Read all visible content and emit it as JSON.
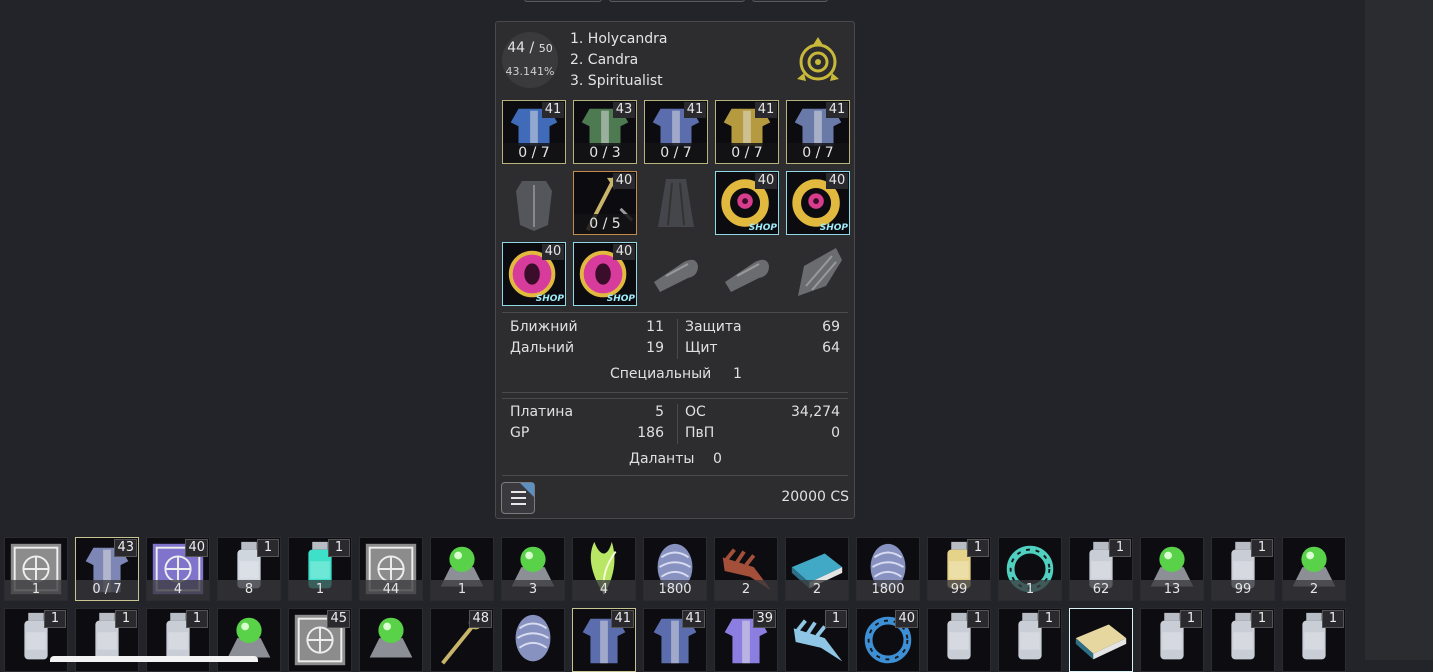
{
  "profile": {
    "level_current": "44",
    "level_sep": " / ",
    "level_max": "50",
    "level_percent": "43.141%",
    "classes": [
      "1. Holycandra",
      "2. Candra",
      "3. Spiritualist"
    ]
  },
  "gear_rows": [
    [
      {
        "name": "armor-top",
        "level": "41",
        "upgrade": "0 / 7",
        "frame": "bordered",
        "color": "#3f6bb8"
      },
      {
        "name": "armor-bottom",
        "level": "43",
        "upgrade": "0 / 3",
        "frame": "bordered",
        "color": "#4e7a52"
      },
      {
        "name": "gloves",
        "level": "41",
        "upgrade": "0 / 7",
        "frame": "bordered",
        "color": "#5b6dad"
      },
      {
        "name": "shoes",
        "level": "41",
        "upgrade": "0 / 7",
        "frame": "bordered",
        "color": "#b59a3f"
      },
      {
        "name": "helm",
        "level": "41",
        "upgrade": "0 / 7",
        "frame": "bordered",
        "color": "#6a7aa8"
      }
    ],
    [
      {
        "name": "shield-slot",
        "level": "",
        "upgrade": "",
        "frame": "empty",
        "color": "#55565c"
      },
      {
        "name": "weapon",
        "level": "40",
        "upgrade": "0 / 5",
        "frame": "bordered-orange",
        "color": "#c9b56a"
      },
      {
        "name": "cape-slot",
        "level": "",
        "upgrade": "",
        "frame": "empty",
        "color": "#45464b"
      },
      {
        "name": "ring-1",
        "level": "40",
        "upgrade": "",
        "frame": "bordered-cyan",
        "color": "#e2b93f",
        "shop": "SHOP"
      },
      {
        "name": "ring-2",
        "level": "40",
        "upgrade": "",
        "frame": "bordered-cyan",
        "color": "#e2b93f",
        "shop": "SHOP"
      }
    ],
    [
      {
        "name": "earring-1",
        "level": "40",
        "upgrade": "",
        "frame": "bordered-cyan",
        "color": "#d73c9c",
        "shop": "SHOP"
      },
      {
        "name": "earring-2",
        "level": "40",
        "upgrade": "",
        "frame": "bordered-cyan",
        "color": "#d73c9c",
        "shop": "SHOP"
      },
      {
        "name": "bullet-slot-1",
        "level": "",
        "upgrade": "",
        "frame": "empty",
        "color": "#6b6c70"
      },
      {
        "name": "bullet-slot-2",
        "level": "",
        "upgrade": "",
        "frame": "empty",
        "color": "#6b6c70"
      },
      {
        "name": "wing-slot",
        "level": "",
        "upgrade": "",
        "frame": "empty",
        "color": "#6b6c70"
      }
    ]
  ],
  "stats": {
    "melee_label": "Ближний",
    "melee_value": "11",
    "ranged_label": "Дальний",
    "ranged_value": "19",
    "defense_label": "Защита",
    "defense_value": "69",
    "shield_label": "Щит",
    "shield_value": "64",
    "special_label": "Специальный",
    "special_value": "1"
  },
  "currency": {
    "platinum_label": "Платина",
    "platinum_value": "5",
    "os_label": "ОС",
    "os_value": "34,274",
    "gp_label": "GP",
    "gp_value": "186",
    "pvp_label": "ПвП",
    "pvp_value": "0",
    "dalant_label": "Даланты",
    "dalant_value": "0",
    "cs_value": "20000 CS"
  },
  "inventory_row1": [
    {
      "count": "1",
      "badge": "",
      "color": "#9a9a9a",
      "kind": "box"
    },
    {
      "count": "0 / 7",
      "badge": "43",
      "color": "#7d86b5",
      "kind": "armor",
      "hl": "hl"
    },
    {
      "count": "4",
      "badge": "40",
      "color": "#8c7ee0",
      "kind": "box"
    },
    {
      "count": "8",
      "badge": "1",
      "color": "#cfd6de",
      "kind": "bottle"
    },
    {
      "count": "1",
      "badge": "1",
      "color": "#3de0c9",
      "kind": "bottle"
    },
    {
      "count": "44",
      "badge": "",
      "color": "#9a9a9a",
      "kind": "box"
    },
    {
      "count": "1",
      "badge": "",
      "color": "#59d24a",
      "kind": "orb"
    },
    {
      "count": "3",
      "badge": "",
      "color": "#59d24a",
      "kind": "orb"
    },
    {
      "count": "4",
      "badge": "",
      "color": "#b9e665",
      "kind": "plant"
    },
    {
      "count": "1800",
      "badge": "",
      "color": "#8792c0",
      "kind": "shell"
    },
    {
      "count": "2",
      "badge": "",
      "color": "#a34f3a",
      "kind": "claw"
    },
    {
      "count": "2",
      "badge": "",
      "color": "#41a8c6",
      "kind": "book"
    },
    {
      "count": "1800",
      "badge": "",
      "color": "#8792c0",
      "kind": "shell"
    },
    {
      "count": "99",
      "badge": "1",
      "color": "#e6d38a",
      "kind": "bottle"
    },
    {
      "count": "1",
      "badge": "",
      "color": "#4fd0c0",
      "kind": "ring"
    },
    {
      "count": "62",
      "badge": "1",
      "color": "#c9ced6",
      "kind": "bottle"
    },
    {
      "count": "13",
      "badge": "",
      "color": "#59d24a",
      "kind": "orb"
    },
    {
      "count": "99",
      "badge": "1",
      "color": "#c9ced6",
      "kind": "bottle"
    },
    {
      "count": "2",
      "badge": "",
      "color": "#59d24a",
      "kind": "orb"
    }
  ],
  "inventory_row2": [
    {
      "badge": "1",
      "color": "#c9ced6",
      "kind": "bottle"
    },
    {
      "badge": "1",
      "color": "#c9ced6",
      "kind": "bottle"
    },
    {
      "badge": "1",
      "color": "#c9ced6",
      "kind": "bottle"
    },
    {
      "badge": "",
      "color": "#59d24a",
      "kind": "orb"
    },
    {
      "badge": "45",
      "color": "#9a9a9a",
      "kind": "box"
    },
    {
      "badge": "",
      "color": "#59d24a",
      "kind": "orb"
    },
    {
      "badge": "48",
      "color": "#c9b56a",
      "kind": "weapon"
    },
    {
      "badge": "",
      "color": "#8792c0",
      "kind": "shell"
    },
    {
      "badge": "41",
      "color": "#5b6dad",
      "kind": "armor",
      "hl": "hl"
    },
    {
      "badge": "41",
      "color": "#5b6dad",
      "kind": "armor"
    },
    {
      "badge": "39",
      "color": "#8c7ee0",
      "kind": "armor"
    },
    {
      "badge": "1",
      "color": "#8fc6e6",
      "kind": "claw"
    },
    {
      "badge": "40",
      "color": "#3d8fd6",
      "kind": "ring"
    },
    {
      "badge": "1",
      "color": "#c9ced6",
      "kind": "bottle"
    },
    {
      "badge": "1",
      "color": "#c9ced6",
      "kind": "bottle"
    },
    {
      "badge": "",
      "color": "#e6d7a0",
      "kind": "book",
      "hl": "hl-cyan"
    },
    {
      "badge": "1",
      "color": "#c9ced6",
      "kind": "bottle"
    },
    {
      "badge": "1",
      "color": "#c9ced6",
      "kind": "bottle"
    },
    {
      "badge": "1",
      "color": "#c9ced6",
      "kind": "bottle"
    }
  ]
}
